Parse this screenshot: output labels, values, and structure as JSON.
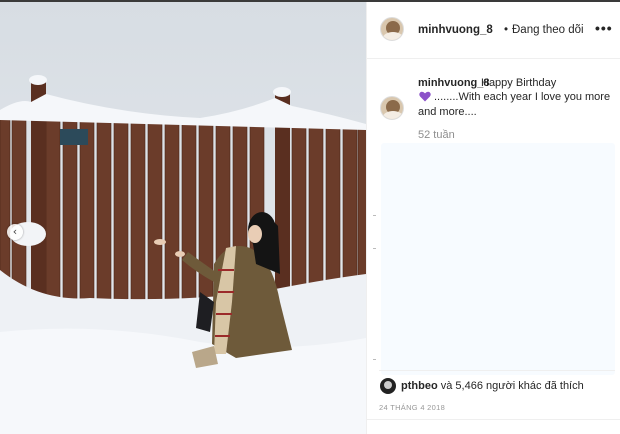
{
  "header": {
    "username": "minhvuong_8",
    "separator": "•",
    "follow_status": "Đang theo dõi",
    "more": "•••"
  },
  "caption": {
    "username": "minhvuong_8",
    "line1": "Happy Birthday",
    "line2": "........With each year I love you more",
    "line3": "and more....",
    "heart_color": "#8c52c9",
    "time": "52 tuần"
  },
  "likes": {
    "user": "pthbeo",
    "rest": "và 5,466 người khác đã thích"
  },
  "date": "24 THÁNG 4 2018",
  "carousel": {
    "prev_icon": "‹"
  },
  "colors": {
    "text": "#262626",
    "secondary": "#8e8e8e",
    "overlay": "#f7fbff"
  }
}
